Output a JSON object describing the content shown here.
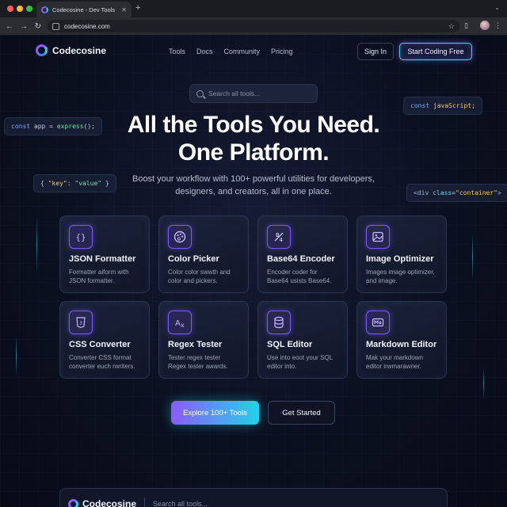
{
  "browser": {
    "tab_title": "Codecosine - Dev Tools",
    "tab_close": "✕",
    "new_tab": "+",
    "url": "codecosine.com"
  },
  "nav": {
    "brand": "Codecosine",
    "links": [
      "Tools",
      "Docs",
      "Community",
      "Pricing"
    ],
    "sign_in": "Sign In",
    "start": "Start Coding Free"
  },
  "search": {
    "placeholder": "Search all tools..."
  },
  "code_snippets": {
    "left_top": {
      "kw": "const",
      "name": " app = ",
      "fn": "express",
      "rest": "();"
    },
    "left_mid": {
      "open": "{ ",
      "key": "\"key\"",
      "colon": ": ",
      "value": "\"value\"",
      "close": " }"
    },
    "right_top": {
      "kw": "const",
      "str": " javaScript",
      "rest": ";"
    },
    "right_mid": {
      "tag": "<div ",
      "attr": "class",
      "eq": "=",
      "val": "\"container\"",
      "close": ">"
    }
  },
  "hero": {
    "title_line1": "All the Tools You Need.",
    "title_line2": "One Platform.",
    "subtitle": "Boost your workflow with 100+ powerful utilities for developers, designers, and creators, all in one place."
  },
  "tools": [
    {
      "name": "JSON Formatter",
      "desc": "Formatter aiform with JSON formatter.",
      "icon": "braces-icon"
    },
    {
      "name": "Color Picker",
      "desc": "Color color swwth and color and pickers.",
      "icon": "palette-icon"
    },
    {
      "name": "Base64 Encoder",
      "desc": "Encoder coder for Base64 usists Base64.",
      "icon": "base64-icon"
    },
    {
      "name": "Image Optimizer",
      "desc": "Images image optimizer, and image.",
      "icon": "image-icon"
    },
    {
      "name": "CSS Converter",
      "desc": "Converter CSS format converter euch rwriters.",
      "icon": "css-icon"
    },
    {
      "name": "Regex Tester",
      "desc": "Tester regex tester Regex tester awards.",
      "icon": "regex-icon"
    },
    {
      "name": "SQL Editor",
      "desc": "Use into eoot your SQL editor into.",
      "icon": "database-icon"
    },
    {
      "name": "Markdown Editor",
      "desc": "Mak your markdown editor irwmarawner.",
      "icon": "markdown-icon"
    }
  ],
  "cta": {
    "explore": "Explore 100+ Tools",
    "get_started": "Get Started"
  },
  "footer": {
    "brand": "Codecosine",
    "search_placeholder": "Search all tools..."
  },
  "colors": {
    "accent_purple": "#8b5cf6",
    "accent_cyan": "#22d3ee",
    "background": "#0b1020"
  }
}
